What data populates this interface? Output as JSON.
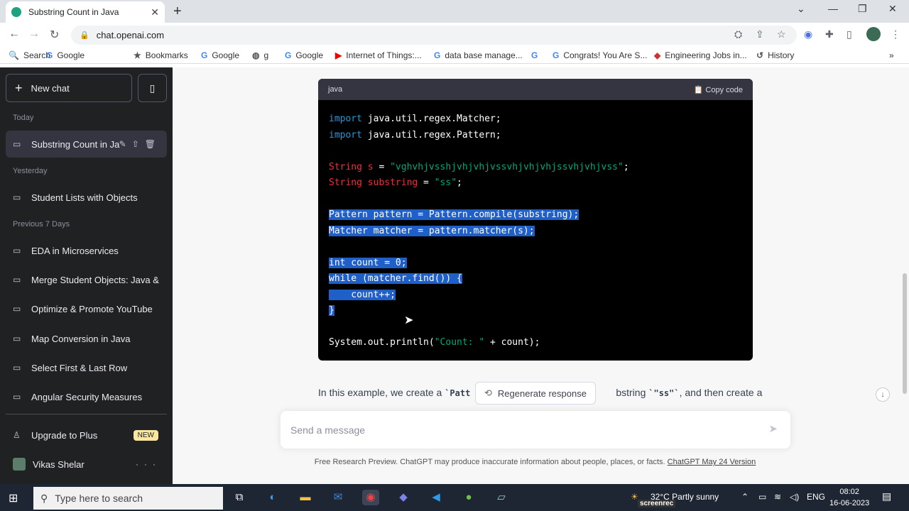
{
  "browser": {
    "tab_title": "Substring Count in Java",
    "url": "chat.openai.com"
  },
  "bookmarks": [
    {
      "icon": "search-icon",
      "label": "Search"
    },
    {
      "icon": "google-icon",
      "label": "Google"
    },
    {
      "icon": "star-icon",
      "label": "Bookmarks"
    },
    {
      "icon": "google-icon",
      "label": "Google"
    },
    {
      "icon": "globe-icon",
      "label": "g"
    },
    {
      "icon": "google-icon",
      "label": "Google"
    },
    {
      "icon": "youtube-icon",
      "label": "Internet of Things:..."
    },
    {
      "icon": "google-icon",
      "label": "data base manage..."
    },
    {
      "icon": "google-icon",
      "label": ""
    },
    {
      "icon": "google-icon",
      "label": "Congrats! You Are S..."
    },
    {
      "icon": "site-icon",
      "label": "Engineering Jobs in..."
    },
    {
      "icon": "history-icon",
      "label": "History"
    }
  ],
  "sidebar": {
    "new_chat": "New chat",
    "today_label": "Today",
    "today_items": [
      "Substring Count in Ja"
    ],
    "yesterday_label": "Yesterday",
    "yesterday_items": [
      "Student Lists with Objects"
    ],
    "prev_label": "Previous 7 Days",
    "prev_items": [
      "EDA in Microservices",
      "Merge Student Objects: Java &",
      "Optimize & Promote YouTube",
      "Map Conversion in Java",
      "Select First & Last Row",
      "Angular Security Measures"
    ],
    "upgrade": "Upgrade to Plus",
    "badge": "NEW",
    "user": "Vikas Shelar"
  },
  "code": {
    "lang": "java",
    "copy": "Copy code"
  },
  "chat": {
    "para_a": "In this example, we create a ",
    "para_code": "`Patt",
    "para_b": "bstring ",
    "para_code2": "`\"ss\"`",
    "para_c": ", and then create a",
    "regen": "Regenerate response",
    "placeholder": "Send a message",
    "footer": "Free Research Preview. ChatGPT may produce inaccurate information about people, places, or facts. ",
    "footer_link": "ChatGPT May 24 Version"
  },
  "taskbar": {
    "search": "Type here to search",
    "weather": "32°C  Partly sunny",
    "lang": "ENG",
    "time": "08:02",
    "date": "16-06-2023",
    "rec": "screenrec"
  }
}
